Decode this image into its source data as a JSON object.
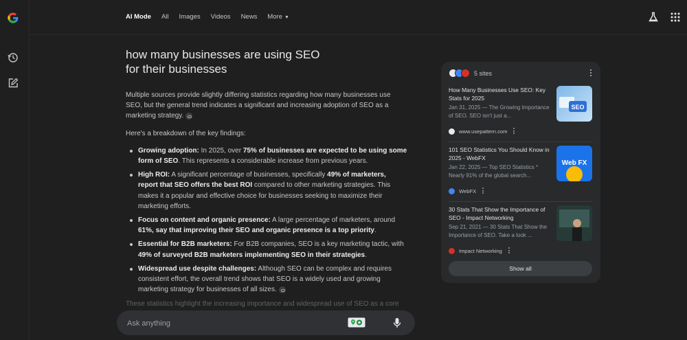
{
  "nav": {
    "tabs": [
      {
        "label": "AI Mode"
      },
      {
        "label": "Images"
      },
      {
        "label": "Videos"
      },
      {
        "label": "News"
      },
      {
        "label": "More"
      }
    ],
    "all_label": "All"
  },
  "query": "how many businesses are using SEO for their businesses",
  "answer": {
    "intro": "Multiple sources provide slightly differing statistics regarding how many businesses use SEO, but the general trend indicates a significant and increasing adoption of SEO as a marketing strategy.",
    "breakdown_heading": "Here's a breakdown of the key findings:",
    "bullets": [
      {
        "lead": "Growing adoption:",
        "pre": " In 2025, over ",
        "bold": "75% of businesses are expected to be using some form of SEO",
        "post": ". This represents a considerable increase from previous years."
      },
      {
        "lead": "High ROI:",
        "pre": " A significant percentage of businesses, specifically ",
        "bold": "49% of marketers, report that SEO offers the best ROI",
        "post": " compared to other marketing strategies. This makes it a popular and effective choice for businesses seeking to maximize their marketing efforts."
      },
      {
        "lead": "Focus on content and organic presence:",
        "pre": " A large percentage of marketers, around ",
        "bold": "61%, say that improving their SEO and organic presence is a top priority",
        "post": "."
      },
      {
        "lead": "Essential for B2B marketers:",
        "pre": " For B2B companies, SEO is a key marketing tactic, with ",
        "bold": "49% of surveyed B2B marketers implementing SEO in their strategies",
        "post": "."
      },
      {
        "lead": "Widespread use despite challenges:",
        "pre": " Although SEO can be complex and requires consistent effort, the overall trend shows that SEO is a widely used and growing marketing strategy for businesses of all sizes.",
        "bold": "",
        "post": ""
      }
    ],
    "faded": "These statistics highlight the increasing importance and widespread use of SEO as a core"
  },
  "ask": {
    "placeholder": "Ask anything"
  },
  "sources": {
    "count_label": "5 sites",
    "items": [
      {
        "title": "How Many Businesses Use SEO: Key Stats for 2025",
        "snippet": "Jan 31, 2025 — The Growing Importance of SEO. SEO isn't just a...",
        "site": "www.usepattern.com",
        "thumb_text": "SEO"
      },
      {
        "title": "101 SEO Statistics You Should Know in 2025 - WebFX",
        "snippet": "Jan 22, 2025 — Top SEO Statistics * Nearly 91% of the global search...",
        "site": "WebFX",
        "thumb_text": "Web FX"
      },
      {
        "title": "30 Stats That Show the Importance of SEO - Impact Networking",
        "snippet": "Sep 21, 2021 — 30 Stats That Show the Importance of SEO. Take a look ...",
        "site": "Impact Networking",
        "thumb_text": ""
      }
    ],
    "show_all": "Show all"
  },
  "colors": {
    "background": "#1f1f1f",
    "panel": "#282a2c",
    "text": "#e3e3e3"
  }
}
